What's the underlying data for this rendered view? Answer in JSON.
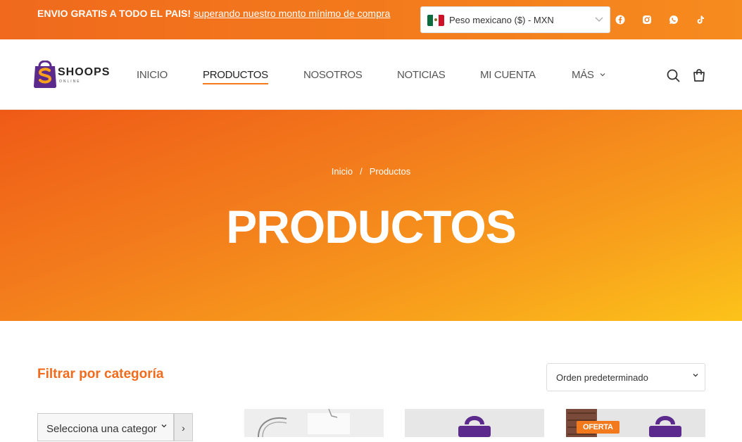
{
  "topbar": {
    "promo_bold": "ENVIO GRATIS A TODO EL PAIS!",
    "promo_link": "superando nuestro monto mínimo de compra",
    "currency_label": "Peso mexicano ($) - MXN",
    "social": [
      "facebook-icon",
      "instagram-icon",
      "whatsapp-icon",
      "tiktok-icon"
    ]
  },
  "header": {
    "logo_text": "SHOOPS",
    "logo_sub": "ONLINE",
    "nav": [
      "INICIO",
      "PRODUCTOS",
      "NOSOTROS",
      "NOTICIAS",
      "MI CUENTA",
      "MÁS"
    ],
    "active_nav": "PRODUCTOS",
    "icons": [
      "search-icon",
      "cart-icon"
    ]
  },
  "hero": {
    "breadcrumb_home": "Inicio",
    "breadcrumb_sep": "/",
    "breadcrumb_current": "Productos",
    "title": "PRODUCTOS"
  },
  "main": {
    "filter_title": "Filtrar por categoría",
    "sort_label": "Orden predeterminado",
    "category_placeholder": "Selecciona una categoría",
    "category_go": "›",
    "sale_badge": "OFERTA"
  },
  "colors": {
    "accent": "#f37a1c",
    "title_orange": "#f26b1c",
    "brand_purple": "#5b2a8c"
  }
}
